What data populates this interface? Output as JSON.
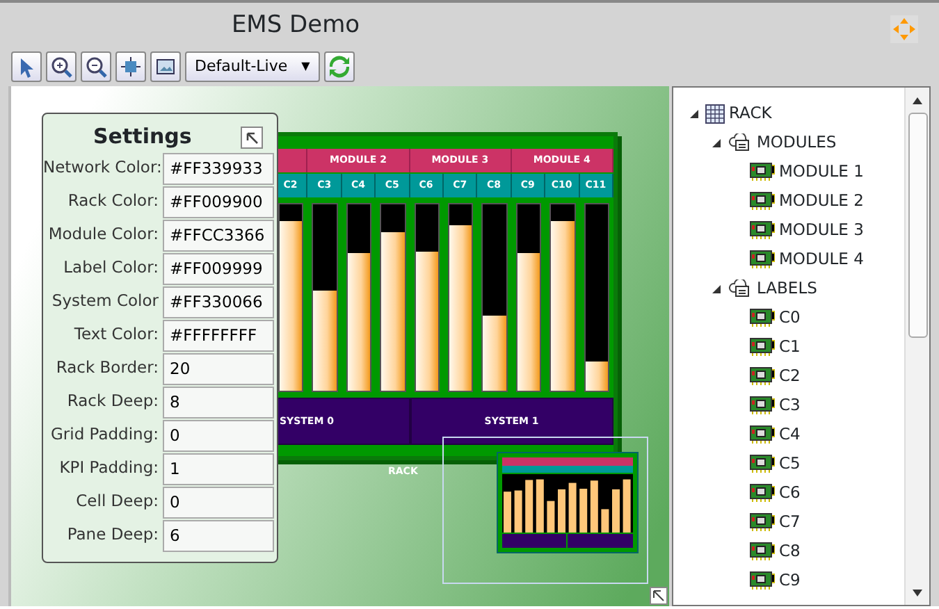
{
  "window": {
    "title": "EMS Demo"
  },
  "toolbar": {
    "tools": [
      {
        "kind": "pointer"
      },
      {
        "kind": "zoom-in"
      },
      {
        "kind": "zoom-out"
      },
      {
        "kind": "fit"
      },
      {
        "kind": "fullscreen"
      }
    ],
    "dropdown": {
      "value": "Default-Live",
      "caret": "▼"
    }
  },
  "settings": {
    "title": "Settings",
    "fields": [
      {
        "label": "Network Color:",
        "value": "#FF339933"
      },
      {
        "label": "Rack Color:",
        "value": "#FF009900"
      },
      {
        "label": "Module Color:",
        "value": "#FFCC3366"
      },
      {
        "label": "Label Color:",
        "value": "#FF009999"
      },
      {
        "label": "System Color",
        "value": "#FF330066"
      },
      {
        "label": "Text Color:",
        "value": "#FFFFFFFF"
      },
      {
        "label": "Rack Border:",
        "value": "20"
      },
      {
        "label": "Rack Deep:",
        "value": "8"
      },
      {
        "label": "Grid Padding:",
        "value": "0"
      },
      {
        "label": "KPI Padding:",
        "value": "1"
      },
      {
        "label": "Cell Deep:",
        "value": "0"
      },
      {
        "label": "Pane Deep:",
        "value": "6"
      }
    ]
  },
  "rack": {
    "label": "RACK",
    "modules": [
      {
        "label": "MODULE 2"
      },
      {
        "label": "MODULE 3"
      },
      {
        "label": "MODULE 4"
      }
    ],
    "cells": [
      {
        "label": "C2",
        "level": 0.91
      },
      {
        "label": "C3",
        "level": 0.54
      },
      {
        "label": "C4",
        "level": 0.74
      },
      {
        "label": "C5",
        "level": 0.85
      },
      {
        "label": "C6",
        "level": 0.75
      },
      {
        "label": "C7",
        "level": 0.89
      },
      {
        "label": "C8",
        "level": 0.4
      },
      {
        "label": "C9",
        "level": 0.74
      },
      {
        "label": "C10",
        "level": 0.91
      },
      {
        "label": "C11",
        "level": 0.16
      }
    ],
    "systems": [
      {
        "label": "SYSTEM 0"
      },
      {
        "label": "SYSTEM 1"
      }
    ]
  },
  "tree": {
    "items": [
      {
        "label": "RACK",
        "kind": "rack",
        "expanded": true,
        "children": [
          {
            "label": "MODULES",
            "kind": "group",
            "expanded": true,
            "children": [
              {
                "label": "MODULE 1",
                "kind": "card"
              },
              {
                "label": "MODULE 2",
                "kind": "card"
              },
              {
                "label": "MODULE 3",
                "kind": "card"
              },
              {
                "label": "MODULE 4",
                "kind": "card"
              }
            ]
          },
          {
            "label": "LABELS",
            "kind": "group",
            "expanded": true,
            "children": [
              {
                "label": "C0",
                "kind": "card"
              },
              {
                "label": "C1",
                "kind": "card"
              },
              {
                "label": "C2",
                "kind": "card"
              },
              {
                "label": "C3",
                "kind": "card"
              },
              {
                "label": "C4",
                "kind": "card"
              },
              {
                "label": "C5",
                "kind": "card"
              },
              {
                "label": "C6",
                "kind": "card"
              },
              {
                "label": "C7",
                "kind": "card"
              },
              {
                "label": "C8",
                "kind": "card"
              },
              {
                "label": "C9",
                "kind": "card"
              }
            ]
          }
        ]
      }
    ]
  }
}
